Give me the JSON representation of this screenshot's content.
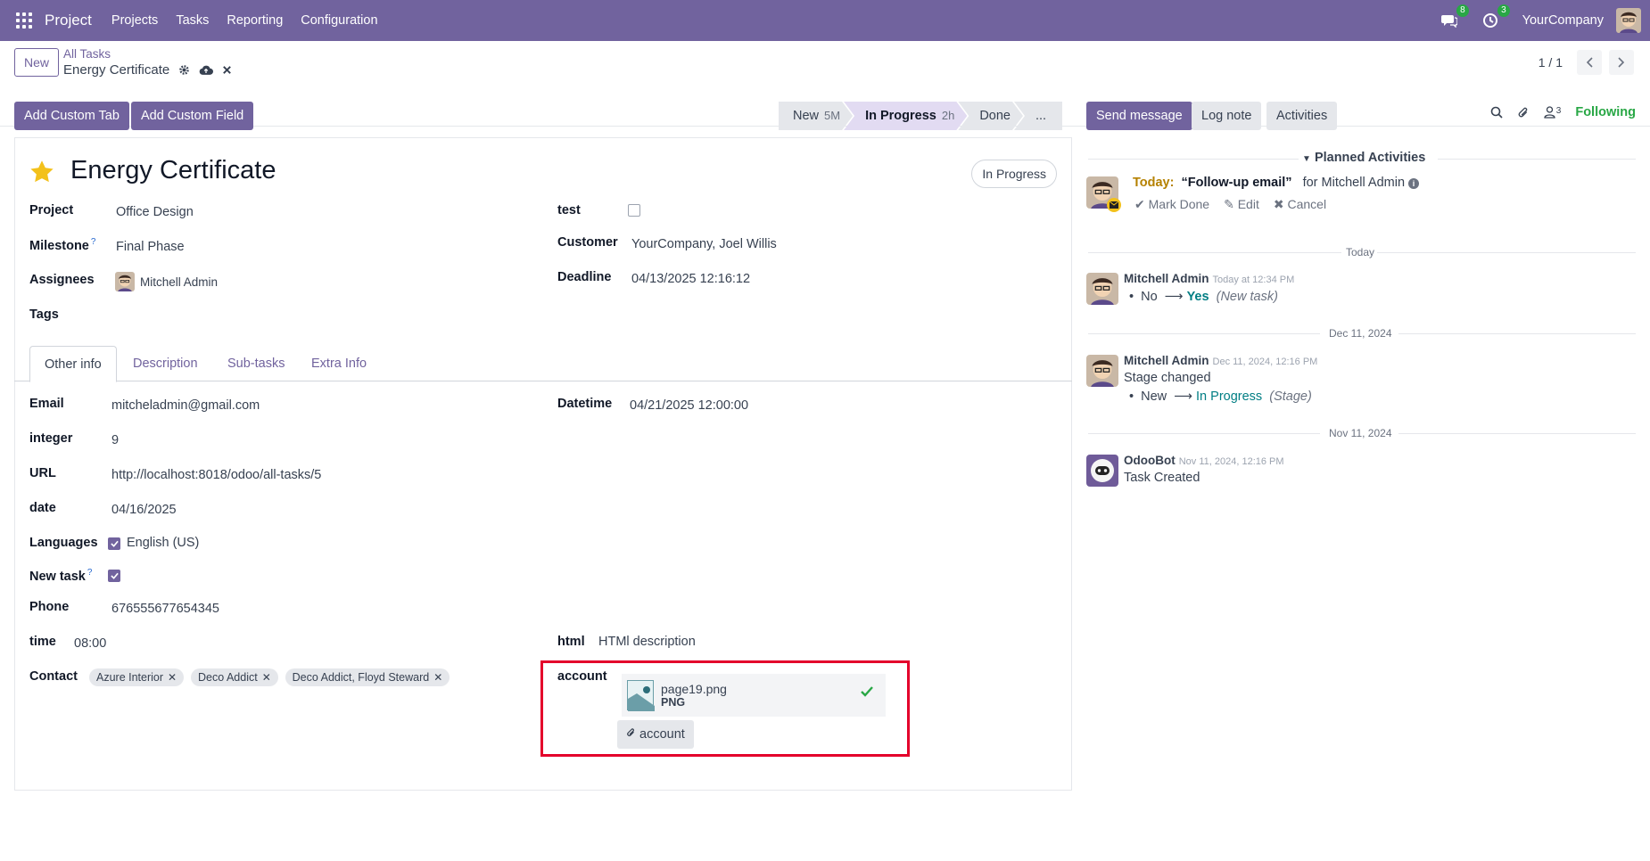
{
  "navbar": {
    "brand": "Project",
    "menu": [
      "Projects",
      "Tasks",
      "Reporting",
      "Configuration"
    ],
    "messages_count": "8",
    "activities_count": "3",
    "company": "YourCompany"
  },
  "control": {
    "new_label": "New",
    "breadcrumb_parent": "All Tasks",
    "breadcrumb_current": "Energy Certificate",
    "pager": "1 / 1"
  },
  "toolbar": {
    "add_tab": "Add Custom Tab",
    "add_field": "Add Custom Field"
  },
  "stages": [
    {
      "label": "New",
      "duration": "5M"
    },
    {
      "label": "In Progress",
      "duration": "2h"
    },
    {
      "label": "Done",
      "duration": ""
    },
    {
      "label": "...",
      "duration": ""
    }
  ],
  "chatter_buttons": {
    "send": "Send message",
    "log": "Log note",
    "activities": "Activities",
    "followers_count": "3",
    "following": "Following"
  },
  "form": {
    "title": "Energy Certificate",
    "stage_pill": "In Progress",
    "fields_left": {
      "project_label": "Project",
      "project_value": "Office Design",
      "milestone_label": "Milestone",
      "milestone_value": "Final Phase",
      "assignees_label": "Assignees",
      "assignees_value": "Mitchell Admin",
      "tags_label": "Tags"
    },
    "fields_right": {
      "test_label": "test",
      "customer_label": "Customer",
      "customer_value": "YourCompany, Joel Willis",
      "deadline_label": "Deadline",
      "deadline_value": "04/13/2025 12:16:12"
    },
    "tabs": [
      "Other info",
      "Description",
      "Sub-tasks",
      "Extra Info"
    ],
    "other_info": {
      "email_label": "Email",
      "email_value": "mitcheladmin@gmail.com",
      "integer_label": "integer",
      "integer_value": "9",
      "url_label": "URL",
      "url_value": "http://localhost:8018/odoo/all-tasks/5",
      "date_label": "date",
      "date_value": "04/16/2025",
      "languages_label": "Languages",
      "languages_value": "English (US)",
      "newtask_label": "New task",
      "phone_label": "Phone",
      "phone_value": "676555677654345",
      "time_label": "time",
      "time_value": "08:00",
      "contact_label": "Contact",
      "contacts": [
        "Azure Interior",
        "Deco Addict",
        "Deco Addict, Floyd Steward"
      ],
      "datetime_label": "Datetime",
      "datetime_value": "04/21/2025 12:00:00",
      "html_label": "html",
      "html_value": "HTMl description",
      "account_label": "account",
      "file_name": "page19.png",
      "file_ext": "PNG",
      "account_button": "account"
    }
  },
  "chatter": {
    "planned_title": "Planned Activities",
    "activity": {
      "today": "Today:",
      "summary": "“Follow-up email”",
      "for": "for Mitchell Admin",
      "mark_done": "Mark Done",
      "edit": "Edit",
      "cancel": "Cancel"
    },
    "sep_today": "Today",
    "msg1": {
      "author": "Mitchell Admin",
      "time": "Today at 12:34 PM",
      "old": "No",
      "new": "Yes",
      "field": "(New task)"
    },
    "sep_dec": "Dec 11, 2024",
    "msg2": {
      "author": "Mitchell Admin",
      "time": "Dec 11, 2024, 12:16 PM",
      "body": "Stage changed",
      "old": "New",
      "new": "In Progress",
      "field": "(Stage)"
    },
    "sep_nov": "Nov 11, 2024",
    "msg3": {
      "author": "OdooBot",
      "time": "Nov 11, 2024, 12:16 PM",
      "body": "Task Created"
    }
  },
  "colors": {
    "brand": "#71639e",
    "success": "#28a745",
    "highlight": "#e4002b",
    "teal": "#017e84"
  }
}
